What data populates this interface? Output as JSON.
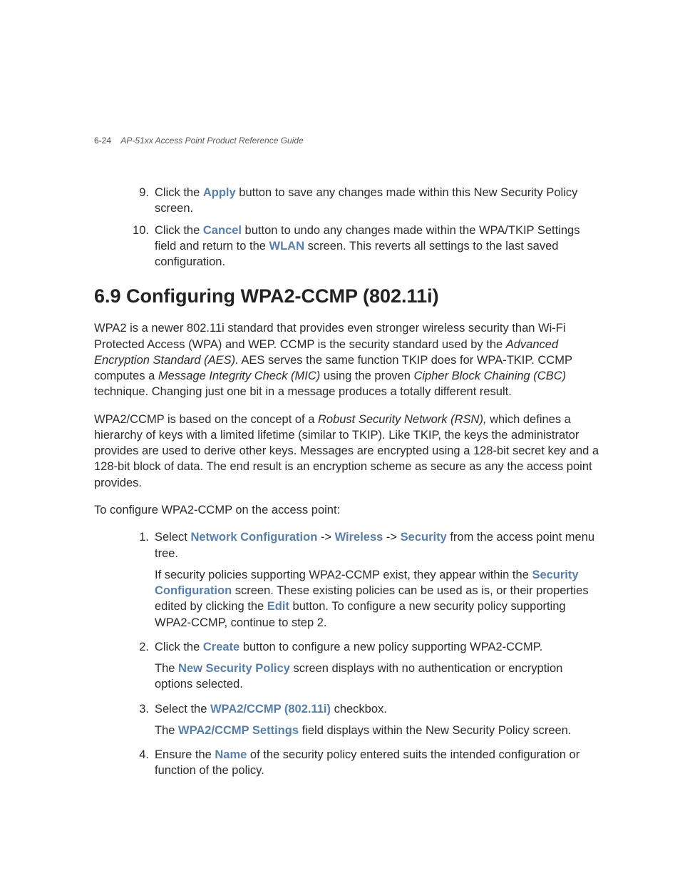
{
  "header": {
    "pagenum": "6-24",
    "guide": "AP-51xx Access Point Product Reference Guide"
  },
  "steps_top": {
    "step9": {
      "t1": "Click the ",
      "b1": "Apply",
      "t2": " button to save any changes made within this New Security Policy screen."
    },
    "step10": {
      "t1": "Click the ",
      "b1": "Cancel",
      "t2": " button to undo any changes made within the WPA/TKIP Settings field and return to the ",
      "b2": "WLAN",
      "t3": " screen. This reverts all settings to the last saved configuration."
    }
  },
  "section_title": "6.9  Configuring WPA2-CCMP (802.11i)",
  "para1": {
    "t1": "WPA2 is a newer 802.11i standard that provides even stronger wireless security than Wi-Fi Protected Access (WPA) and WEP. CCMP is the security standard used by the ",
    "i1": "Advanced Encryption Standard (AES).",
    "t2": " AES serves the same function TKIP does for WPA-TKIP. CCMP computes a ",
    "i2": "Message Integrity Check (MIC)",
    "t3": " using the proven ",
    "i3": "Cipher Block Chaining (CBC)",
    "t4": " technique. Changing just one bit in a message produces a totally different result."
  },
  "para2": {
    "t1": "WPA2/CCMP is based on the concept of a ",
    "i1": "Robust Security Network (RSN),",
    "t2": " which defines a hierarchy of keys with a limited lifetime (similar to TKIP). Like TKIP, the keys the administrator provides are used to derive other keys. Messages are encrypted using a 128-bit secret key and a 128-bit block of data. The end result is an encryption scheme as secure as any the access point provides."
  },
  "para3": "To configure WPA2-CCMP on the access point:",
  "steps_bottom": {
    "s1": {
      "t1": "Select ",
      "b1": "Network Configuration",
      "t2": " -> ",
      "b2": "Wireless",
      "t3": " -> ",
      "b3": "Security",
      "t4": " from the access point menu tree.",
      "sub_t1": "If security policies supporting WPA2-CCMP exist, they appear within the ",
      "sub_b1": "Security Configuration",
      "sub_t2": " screen. These existing policies can be used as is, or their properties edited by clicking the ",
      "sub_b2": "Edit",
      "sub_t3": " button. To configure a new security policy supporting WPA2-CCMP, continue to step 2."
    },
    "s2": {
      "t1": "Click the ",
      "b1": "Create",
      "t2": " button to configure a new policy supporting WPA2-CCMP.",
      "sub_t1": "The ",
      "sub_b1": "New Security Policy",
      "sub_t2": " screen displays with no authentication or encryption options selected."
    },
    "s3": {
      "t1": "Select the ",
      "b1": "WPA2/CCMP (802.11i)",
      "t2": " checkbox.",
      "sub_t1": "The ",
      "sub_b1": "WPA2/CCMP Settings",
      "sub_t2": " field displays within the New Security Policy screen."
    },
    "s4": {
      "t1": "Ensure the ",
      "b1": "Name",
      "t2": " of the security policy entered suits the intended configuration or function of the policy."
    }
  }
}
